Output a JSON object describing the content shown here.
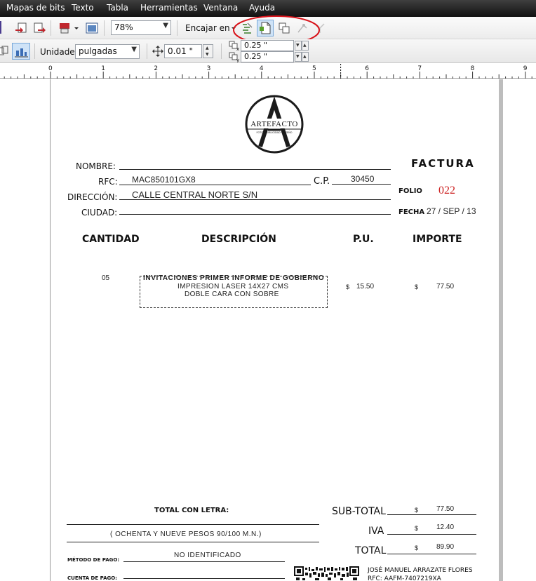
{
  "menu": [
    "Mapas de bits",
    "Texto",
    "Tabla",
    "Herramientas",
    "Ventana",
    "Ayuda"
  ],
  "toolbar": {
    "zoom": "78%",
    "fit_label": "Encajar en",
    "units_label": "Unidades:",
    "units_value": "pulgadas",
    "nudge_value": "0.01 \"",
    "dup_x": "0.25 \"",
    "dup_y": "0.25 \""
  },
  "ruler": {
    "ticks": [
      "0",
      "1",
      "2",
      "3",
      "4",
      "5",
      "6",
      "7",
      "8",
      "9"
    ]
  },
  "invoice": {
    "logo": {
      "name": "ARTEFACTO",
      "sub": "FOTO · PUBLICIDAD · DISEÑO"
    },
    "title": "FACTURA",
    "nombre_label": "NOMBRE:",
    "rfc_label": "RFC:",
    "rfc_value": "MAC850101GX8",
    "cp_label": "C.P.",
    "cp_value": "30450",
    "direccion_label": "DIRECCIÓN:",
    "direccion_value": "CALLE CENTRAL NORTE S/N",
    "ciudad_label": "CIUDAD:",
    "folio_label": "FOLIO",
    "folio_value": "022",
    "fecha_label": "FECHA",
    "fecha_value": "27 / SEP / 13",
    "columns": [
      "CANTIDAD",
      "DESCRIPCIÓN",
      "P.U.",
      "IMPORTE"
    ],
    "item": {
      "cantidad": "05",
      "desc_lines": [
        "INVITACIONES PRIMER INFORME DE GOBIERNO",
        "IMPRESION LASER 14X27 CMS",
        "DOBLE CARA CON SOBRE"
      ],
      "pu_currency": "$",
      "pu": "15.50",
      "importe_currency": "$",
      "importe": "77.50"
    },
    "total_letra_label": "TOTAL CON LETRA:",
    "total_letra_value": "( OCHENTA Y NUEVE PESOS  90/100 M.N.)",
    "metodo_label": "MÉTODO DE PAGO:",
    "metodo_value": "NO IDENTIFICADO",
    "cuenta_label": "CUENTA DE PAGO:",
    "subtotal_label": "SUB-TOTAL",
    "subtotal_currency": "$",
    "subtotal_value": "77.50",
    "iva_label": "IVA",
    "iva_currency": "$",
    "iva_value": "12.40",
    "total_label": "TOTAL",
    "total_currency": "$",
    "total_value": "89.90",
    "issuer_name": "JOSÉ MANUEL ARRAZATE FLORES",
    "issuer_rfc": "RFC: AAFM-7407219XA"
  },
  "colors": {
    "folio": "#cc1f1f",
    "annotation_ellipse": "#d9141b"
  }
}
